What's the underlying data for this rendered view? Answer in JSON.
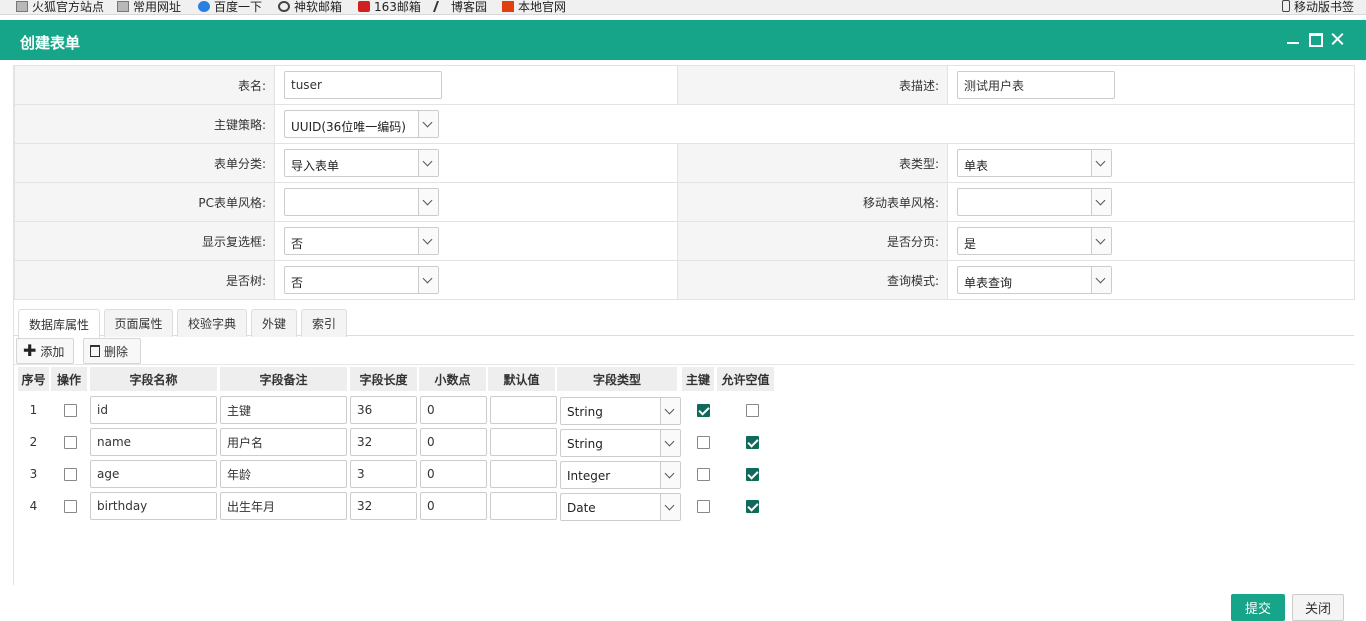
{
  "bookmarks": [
    {
      "label": "火狐官方站点",
      "icon": "folder-icon"
    },
    {
      "label": "常用网址",
      "icon": "folder-icon"
    },
    {
      "label": "百度一下",
      "icon": "baidu-paw-icon"
    },
    {
      "label": "神软邮箱",
      "icon": "globe-icon"
    },
    {
      "label": "163邮箱",
      "icon": "mail-163-icon"
    },
    {
      "label": "博客园",
      "icon": "cnblogs-icon"
    },
    {
      "label": "本地官网",
      "icon": "local-site-icon"
    }
  ],
  "mobile_bookmarks": "移动版书签",
  "dialog": {
    "title": "创建表单",
    "accent_color": "#17a589"
  },
  "form": {
    "table_name_label": "表名:",
    "table_name_value": "tuser",
    "table_desc_label": "表描述:",
    "table_desc_value": "测试用户表",
    "pk_strategy_label": "主键策略:",
    "pk_strategy_value": "UUID(36位唯一编码)",
    "form_category_label": "表单分类:",
    "form_category_value": "导入表单",
    "table_type_label": "表类型:",
    "table_type_value": "单表",
    "pc_style_label": "PC表单风格:",
    "pc_style_value": "",
    "mobile_style_label": "移动表单风格:",
    "mobile_style_value": "",
    "show_checkbox_label": "显示复选框:",
    "show_checkbox_value": "否",
    "paging_label": "是否分页:",
    "paging_value": "是",
    "is_tree_label": "是否树:",
    "is_tree_value": "否",
    "query_mode_label": "查询模式:",
    "query_mode_value": "单表查询"
  },
  "tabs": [
    {
      "label": "数据库属性",
      "active": true
    },
    {
      "label": "页面属性",
      "active": false
    },
    {
      "label": "校验字典",
      "active": false
    },
    {
      "label": "外键",
      "active": false
    },
    {
      "label": "索引",
      "active": false
    }
  ],
  "toolbar": {
    "add_label": "添加",
    "delete_label": "删除"
  },
  "grid": {
    "headers": [
      "序号",
      "操作",
      "字段名称",
      "字段备注",
      "字段长度",
      "小数点",
      "默认值",
      "字段类型",
      "主键",
      "允许空值"
    ],
    "rows": [
      {
        "seq": "1",
        "name": "id",
        "remark": "主键",
        "length": "36",
        "decimal": "0",
        "default": "",
        "type": "String",
        "pk": true,
        "nullable": false
      },
      {
        "seq": "2",
        "name": "name",
        "remark": "用户名",
        "length": "32",
        "decimal": "0",
        "default": "",
        "type": "String",
        "pk": false,
        "nullable": true
      },
      {
        "seq": "3",
        "name": "age",
        "remark": "年龄",
        "length": "3",
        "decimal": "0",
        "default": "",
        "type": "Integer",
        "pk": false,
        "nullable": true
      },
      {
        "seq": "4",
        "name": "birthday",
        "remark": "出生年月",
        "length": "32",
        "decimal": "0",
        "default": "",
        "type": "Date",
        "pk": false,
        "nullable": true
      }
    ]
  },
  "footer": {
    "submit_label": "提交",
    "close_label": "关闭"
  }
}
